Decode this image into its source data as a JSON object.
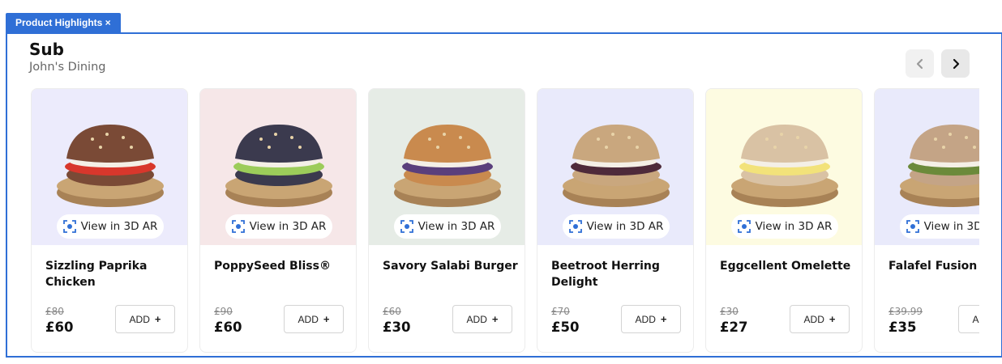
{
  "tag": {
    "label": "Product Highlights ×"
  },
  "header": {
    "title": "Sub",
    "subtitle": "John's Dining"
  },
  "nav": {
    "prev_icon": "chevron-left-icon",
    "next_icon": "chevron-right-icon"
  },
  "ar_label": "View in 3D AR",
  "add_label": "ADD",
  "add_icon": "+",
  "products": [
    {
      "name": "Sizzling Paprika Chicken",
      "old_price": "£80",
      "price": "£60",
      "bg": "#ecebfc",
      "filling": "#d8372c",
      "bun": "#7a4a36"
    },
    {
      "name": "PoppySeed Bliss®",
      "old_price": "£90",
      "price": "£60",
      "bg": "#f6e7e8",
      "filling": "#9ccc5a",
      "bun": "#3b3a4e"
    },
    {
      "name": "Savory Salabi Burger",
      "old_price": "£60",
      "price": "£30",
      "bg": "#e6ece6",
      "filling": "#5a3f7c",
      "bun": "#c98a4e"
    },
    {
      "name": "Beetroot Herring Delight",
      "old_price": "£70",
      "price": "£50",
      "bg": "#e9eafb",
      "filling": "#4e2a3a",
      "bun": "#c9a77e"
    },
    {
      "name": "Eggcellent Omelette",
      "old_price": "£30",
      "price": "£27",
      "bg": "#fdfbe1",
      "filling": "#f2e27a",
      "bun": "#d9c2a4"
    },
    {
      "name": "Falafel Fusion Su",
      "old_price": "£39.99",
      "price": "£35",
      "bg": "#e9eafb",
      "filling": "#6b8a3a",
      "bun": "#c4a486"
    }
  ]
}
